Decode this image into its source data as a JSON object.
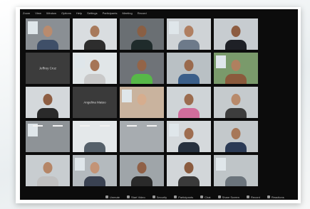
{
  "menubar": {
    "items": [
      "Zoom",
      "View",
      "Window",
      "Options",
      "Help",
      "Settings",
      "Participants",
      "Meeting",
      "Record"
    ]
  },
  "tiles": [
    {
      "name": "",
      "wall": "#8a8f94",
      "skin": "#b98b6e",
      "shirt": "#3f4f68"
    },
    {
      "name": "",
      "wall": "#d9dde0",
      "skin": "#a87a5c",
      "shirt": "#2d2d2d"
    },
    {
      "name": "",
      "wall": "#6a6f73",
      "skin": "#8a5f44",
      "shirt": "#1f2b2b"
    },
    {
      "name": "",
      "wall": "#cfd3d6",
      "skin": "#b07f61",
      "shirt": "#6d7a8a"
    },
    {
      "name": "",
      "wall": "#c7ccd0",
      "skin": "#8d5c40",
      "shirt": "#1e2026"
    },
    {
      "name": "Jeffrey Cruz",
      "wall": "#3c3c3c",
      "skin": "",
      "shirt": ""
    },
    {
      "name": "",
      "wall": "#e1e6e8",
      "skin": "#a67556",
      "shirt": "#c9c9c9"
    },
    {
      "name": "",
      "wall": "#6f7378",
      "skin": "#936448",
      "shirt": "#57b848"
    },
    {
      "name": "",
      "wall": "#b9c0c4",
      "skin": "#9a6a4d",
      "shirt": "#3b5f8a"
    },
    {
      "name": "",
      "wall": "#7a9a6b",
      "skin": "#b0805f",
      "shirt": "#8b5a3c"
    },
    {
      "name": "",
      "wall": "#d4d8db",
      "skin": "#8e5e43",
      "shirt": "#2a2a2a"
    },
    {
      "name": "Angelina Mateo",
      "wall": "#3a3a3a",
      "skin": "",
      "shirt": ""
    },
    {
      "name": "",
      "wall": "#c9b39e",
      "skin": "#d6ad8e",
      "shirt": "#c9b39e"
    },
    {
      "name": "",
      "wall": "#cfd4d7",
      "skin": "#9b6c4f",
      "shirt": "#d16d9c"
    },
    {
      "name": "",
      "wall": "#c5cacd",
      "skin": "#b88a6b",
      "shirt": "#3d3d3d"
    },
    {
      "name": "",
      "wall": "#8e9397",
      "skin": "",
      "shirt": ""
    },
    {
      "name": "",
      "wall": "#e4e8ea",
      "skin": "",
      "shirt": "#55606a"
    },
    {
      "name": "",
      "wall": "#a7acb0",
      "skin": "",
      "shirt": ""
    },
    {
      "name": "",
      "wall": "#d5d9dc",
      "skin": "#9e6d50",
      "shirt": "#27313f"
    },
    {
      "name": "",
      "wall": "#c3c8cb",
      "skin": "#a77758",
      "shirt": "#2b3a55"
    },
    {
      "name": "",
      "wall": "#c8cdd0",
      "skin": "#b58667",
      "shirt": "#c0c0c0"
    },
    {
      "name": "",
      "wall": "#b4babe",
      "skin": "#c39477",
      "shirt": "#3a4252"
    },
    {
      "name": "",
      "wall": "#9fa5a9",
      "skin": "#8f6046",
      "shirt": "#2a2a2a"
    },
    {
      "name": "",
      "wall": "#d2d6d9",
      "skin": "#8a5b3f",
      "shirt": "#3a3a3a"
    },
    {
      "name": "",
      "wall": "#bfc5c8",
      "skin": "",
      "shirt": "#6b747c"
    }
  ],
  "toolbar": {
    "items": [
      "Unmute",
      "Start Video",
      "Security",
      "Participants",
      "Chat",
      "Share Screen",
      "Record",
      "Reactions"
    ],
    "end_label": "End"
  }
}
